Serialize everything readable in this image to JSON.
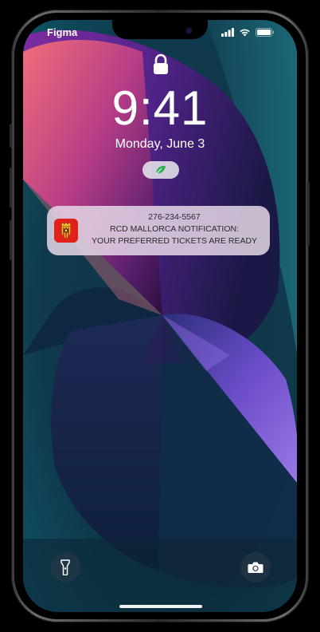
{
  "status_bar": {
    "carrier": "Figma",
    "icons": [
      "cellular-signal-icon",
      "wifi-icon",
      "battery-icon"
    ]
  },
  "lock_screen": {
    "lock_icon": "lock-icon",
    "time": "9:41",
    "date": "Monday, June 3",
    "focus_pill_icon": "leaf-icon"
  },
  "notification": {
    "app_icon": "rcd-mallorca-crest-icon",
    "sender": "276-234-5567",
    "line1": "RCD MALLORCA NOTIFICATION:",
    "line2": "YOUR PREFERRED TICKETS ARE READY"
  },
  "bottom_controls": {
    "left_icon": "flashlight-icon",
    "right_icon": "camera-icon"
  },
  "colors": {
    "notification_bg": "#e4d6e6",
    "app_icon_bg": "#e0201a",
    "pill_icon": "#2fae4e"
  }
}
